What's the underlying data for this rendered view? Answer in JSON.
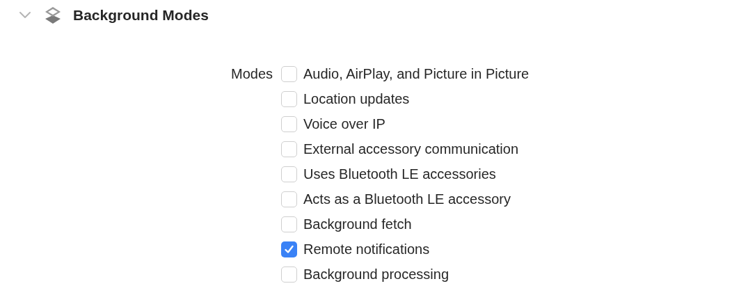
{
  "section": {
    "title": "Background Modes",
    "expanded": true
  },
  "modes": {
    "label": "Modes",
    "options": [
      {
        "label": "Audio, AirPlay, and Picture in Picture",
        "checked": false
      },
      {
        "label": "Location updates",
        "checked": false
      },
      {
        "label": "Voice over IP",
        "checked": false
      },
      {
        "label": "External accessory communication",
        "checked": false
      },
      {
        "label": "Uses Bluetooth LE accessories",
        "checked": false
      },
      {
        "label": "Acts as a Bluetooth LE accessory",
        "checked": false
      },
      {
        "label": "Background fetch",
        "checked": false
      },
      {
        "label": "Remote notifications",
        "checked": true
      },
      {
        "label": "Background processing",
        "checked": false
      }
    ]
  }
}
